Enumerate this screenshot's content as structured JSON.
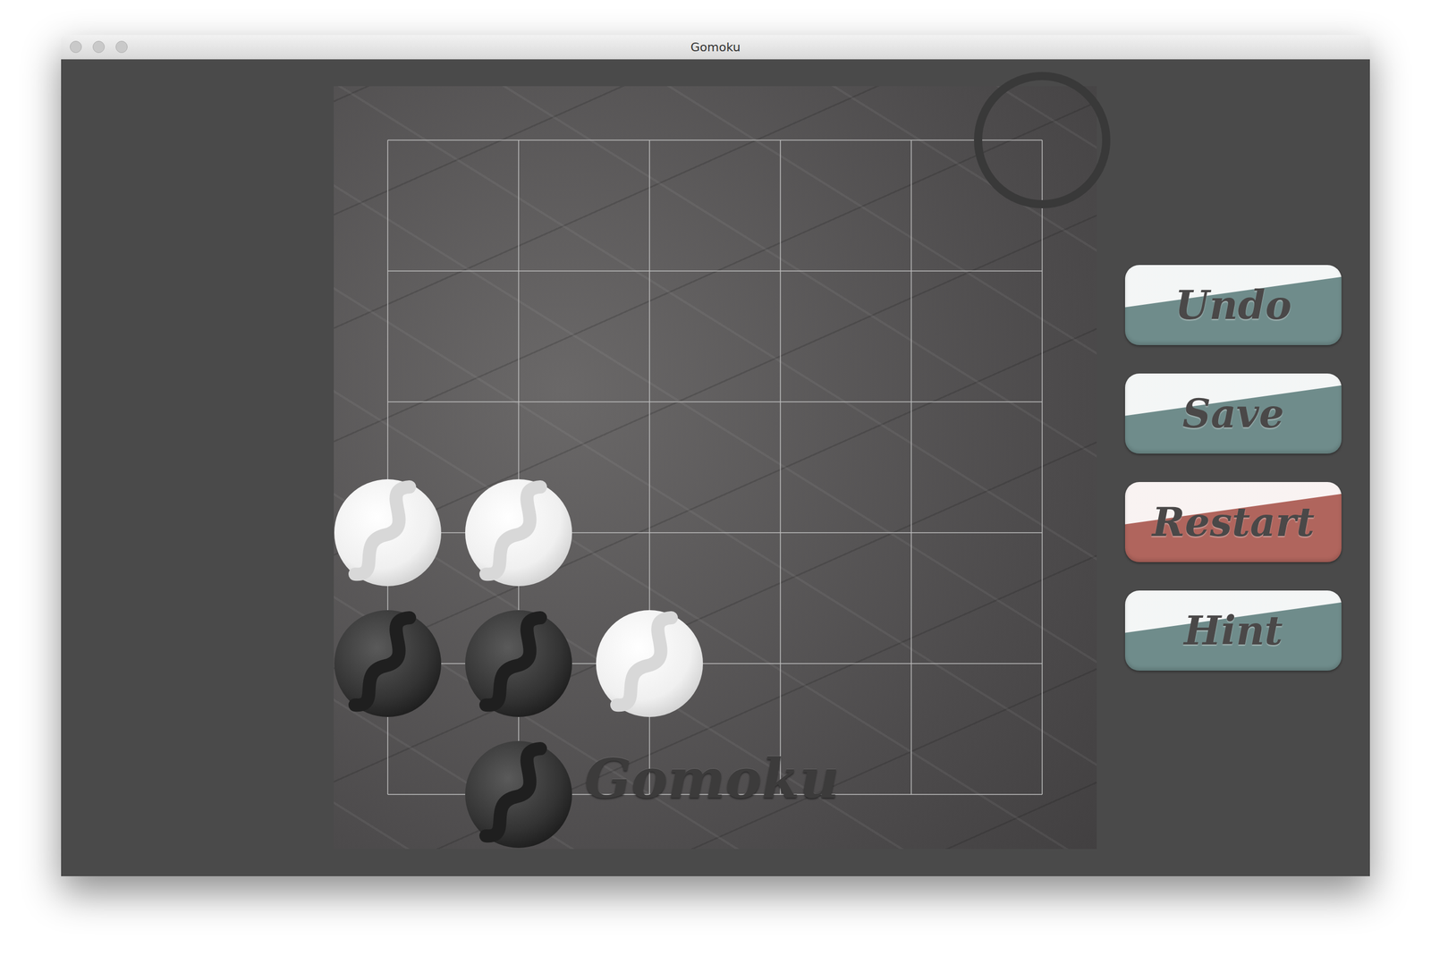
{
  "window": {
    "title": "Gomoku"
  },
  "board": {
    "size": 6,
    "watermark": "Gomoku",
    "cursor": {
      "col": 5,
      "row": 0
    },
    "stones": [
      {
        "col": 0,
        "row": 3,
        "player": "white"
      },
      {
        "col": 1,
        "row": 3,
        "player": "white"
      },
      {
        "col": 0,
        "row": 4,
        "player": "black"
      },
      {
        "col": 1,
        "row": 4,
        "player": "black"
      },
      {
        "col": 2,
        "row": 4,
        "player": "white"
      },
      {
        "col": 1,
        "row": 5,
        "player": "black"
      }
    ]
  },
  "buttons": [
    {
      "label": "Undo",
      "color": "#6f8c8b"
    },
    {
      "label": "Save",
      "color": "#6f8c8b"
    },
    {
      "label": "Restart",
      "color": "#b0655d"
    },
    {
      "label": "Hint",
      "color": "#6f8c8b"
    }
  ]
}
